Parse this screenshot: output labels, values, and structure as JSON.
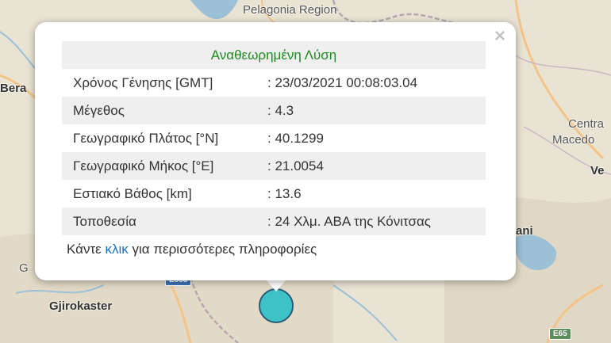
{
  "map": {
    "labels": {
      "pelagonia": "Pelagonia Region",
      "berat": "Bera",
      "central_macedonia_1": "Centra",
      "central_macedonia_2": "Macedo",
      "veria": "Ve",
      "kozani": "ani",
      "gjirokaster": "Gjirokaster",
      "g_edge": "G"
    },
    "shields": {
      "e65": "E65",
      "e853": "E853"
    },
    "colors": {
      "land": "#e8e2d2",
      "water": "#9cc0d6",
      "road": "#f2c488",
      "border": "#b7a7b0"
    }
  },
  "popup": {
    "title": "Αναθεωρημένη Λύση",
    "rows": [
      {
        "key": "Χρόνος Γένησης [GMT]",
        "value": ": 23/03/2021 00:08:03.04"
      },
      {
        "key": "Μέγεθος",
        "value": ": 4.3"
      },
      {
        "key": "Γεωγραφικό Πλάτος [°N]",
        "value": ": 40.1299"
      },
      {
        "key": "Γεωγραφικό Μήκος [°E]",
        "value": ": 21.0054"
      },
      {
        "key": "Εστιακό Βάθος [km]",
        "value": ": 13.6"
      },
      {
        "key": "Τοποθεσία",
        "value": ": 24 Χλμ. ΑΒΑ της Κόνιτσας"
      }
    ],
    "more": {
      "before": "Κάντε ",
      "link": "κλικ",
      "after": " για περισσότερες πληροφορίες"
    },
    "close_icon": "close-icon",
    "close_glyph": "×",
    "title_color": "#1f8a1f"
  },
  "marker": {
    "color": "#3fc2c6"
  }
}
